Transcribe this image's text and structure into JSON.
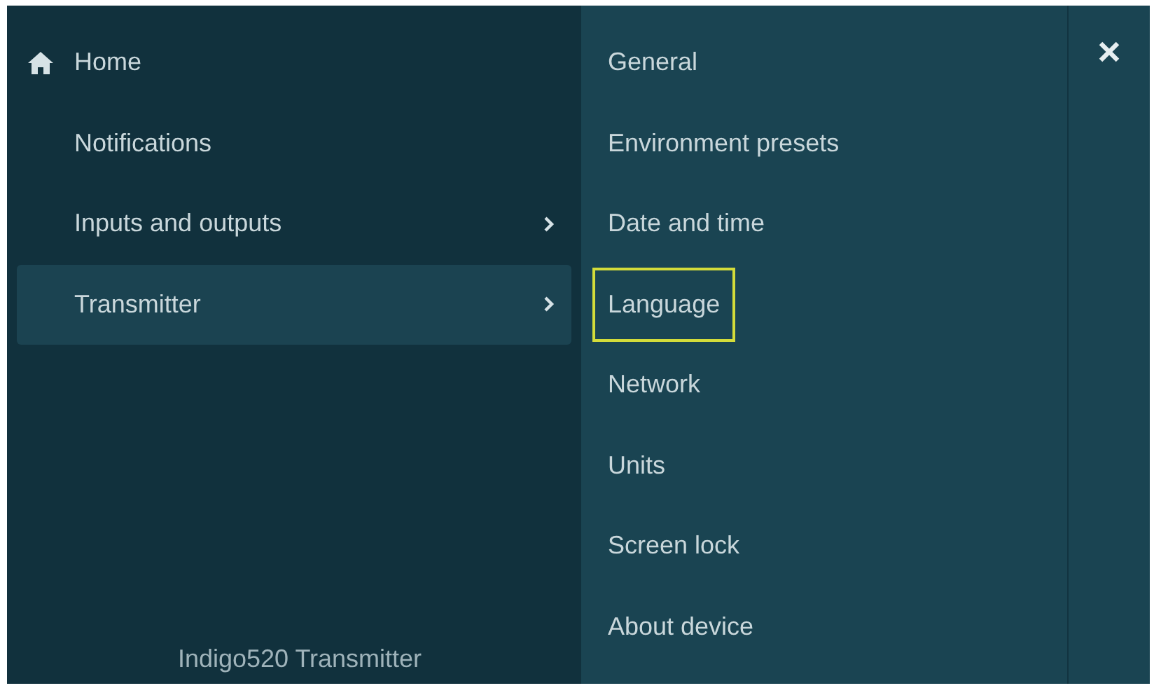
{
  "left_menu": {
    "items": [
      {
        "label": "Home",
        "kind": "home",
        "selected": false
      },
      {
        "label": "Notifications",
        "kind": "plain",
        "selected": false
      },
      {
        "label": "Inputs and outputs",
        "kind": "submenu",
        "selected": false
      },
      {
        "label": "Transmitter",
        "kind": "submenu",
        "selected": true
      }
    ],
    "footer": "Indigo520 Transmitter"
  },
  "submenu": {
    "items": [
      {
        "label": "General",
        "focused": false
      },
      {
        "label": "Environment presets",
        "focused": false
      },
      {
        "label": "Date and time",
        "focused": false
      },
      {
        "label": "Language",
        "focused": true
      },
      {
        "label": "Network",
        "focused": false
      },
      {
        "label": "Units",
        "focused": false
      },
      {
        "label": "Screen lock",
        "focused": false
      },
      {
        "label": "About device",
        "focused": false
      }
    ]
  }
}
